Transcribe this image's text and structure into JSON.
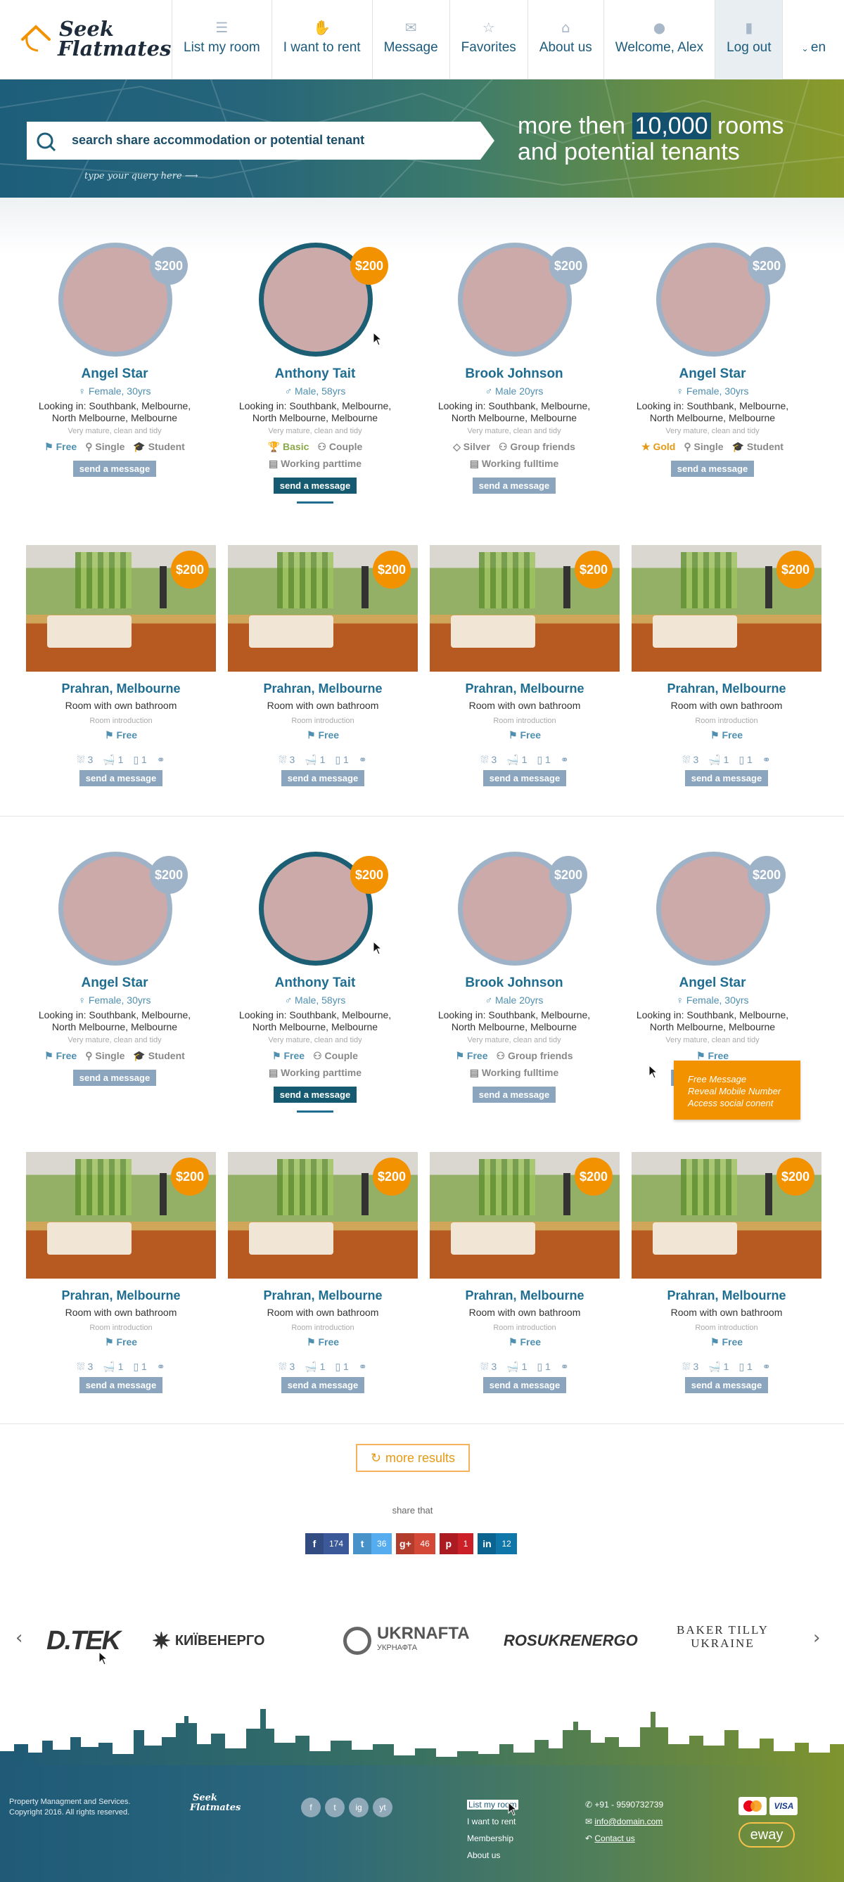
{
  "brand": {
    "line1": "Seek",
    "line2": "Flatmates"
  },
  "nav": [
    {
      "label": "List my room",
      "icon": "list-icon"
    },
    {
      "label": "I want to rent",
      "icon": "handshake-icon"
    },
    {
      "label": "Message",
      "icon": "envelope-icon"
    },
    {
      "label": "Favorites",
      "icon": "star-icon"
    },
    {
      "label": "About us",
      "icon": "house-icon"
    },
    {
      "label": "Welcome, Alex",
      "icon": "user-icon"
    },
    {
      "label": "Log out",
      "icon": "door-icon"
    }
  ],
  "lang": {
    "label": "en",
    "icon": "chevron-down-icon"
  },
  "hero": {
    "search_placeholder": "search share accommodation or potential tenant",
    "hint": "type your query here",
    "line1_pre": "more then ",
    "line1_num": "10,000",
    "line1_post": " rooms",
    "line2": "and potential tenants"
  },
  "people_row": [
    {
      "name": "Angel Star",
      "meta": "Female, 30yrs",
      "gender": "female",
      "price": "$200",
      "looking1": "Looking in: Southbank, Melbourne,",
      "looking2": "North Melbourne, Melbourne",
      "desc": "Very mature, clean and tidy",
      "plan": "Free",
      "plan_style": "blue",
      "type": "Single",
      "type3": "Student",
      "work": "",
      "active": false
    },
    {
      "name": "Anthony Tait",
      "meta": "Male, 58yrs",
      "gender": "male",
      "price": "$200",
      "looking1": "Looking in: Southbank, Melbourne,",
      "looking2": "North Melbourne, Melbourne",
      "desc": "Very mature, clean and tidy",
      "plan": "Basic",
      "plan_style": "green",
      "type": "Couple",
      "type3": "",
      "work": "Working parttime",
      "active": true
    },
    {
      "name": "Brook Johnson",
      "meta": "Male 20yrs",
      "gender": "male",
      "price": "$200",
      "looking1": "Looking in: Southbank, Melbourne,",
      "looking2": "North Melbourne, Melbourne",
      "desc": "Very mature, clean and tidy",
      "plan": "Silver",
      "plan_style": "",
      "type": "Group friends",
      "type3": "",
      "work": "Working fulltime",
      "active": false
    },
    {
      "name": "Angel Star",
      "meta": "Female, 30yrs",
      "gender": "female",
      "price": "$200",
      "looking1": "Looking in: Southbank, Melbourne,",
      "looking2": "North Melbourne, Melbourne",
      "desc": "Very mature, clean and tidy",
      "plan": "Gold",
      "plan_style": "gold",
      "type": "Single",
      "type3": "Student",
      "work": "",
      "active": false
    }
  ],
  "people_row2": [
    {
      "name": "Angel Star",
      "meta": "Female, 30yrs",
      "gender": "female",
      "price": "$200",
      "looking1": "Looking in: Southbank, Melbourne,",
      "looking2": "North Melbourne, Melbourne",
      "desc": "Very mature, clean and tidy",
      "plan": "Free",
      "plan_style": "blue",
      "type": "Single",
      "type3": "Student",
      "work": "",
      "active": false
    },
    {
      "name": "Anthony Tait",
      "meta": "Male, 58yrs",
      "gender": "male",
      "price": "$200",
      "looking1": "Looking in: Southbank, Melbourne,",
      "looking2": "North Melbourne, Melbourne",
      "desc": "Very mature, clean and tidy",
      "plan": "Free",
      "plan_style": "blue",
      "type": "Couple",
      "type3": "",
      "work": "Working parttime",
      "active": true
    },
    {
      "name": "Brook Johnson",
      "meta": "Male 20yrs",
      "gender": "male",
      "price": "$200",
      "looking1": "Looking in: Southbank, Melbourne,",
      "looking2": "North Melbourne, Melbourne",
      "desc": "Very mature, clean and tidy",
      "plan": "Free",
      "plan_style": "blue",
      "type": "Group friends",
      "type3": "",
      "work": "Working fulltime",
      "active": false
    },
    {
      "name": "Angel Star",
      "meta": "Female, 30yrs",
      "gender": "female",
      "price": "$200",
      "looking1": "Looking in: Southbank, Melbourne,",
      "looking2": "North Melbourne, Melbourne",
      "desc": "Very mature, clean and tidy",
      "plan": "Free",
      "plan_style": "blue",
      "type": "",
      "type3": "",
      "work": "",
      "active": false
    }
  ],
  "room": {
    "price": "$200",
    "city": "Prahran, Melbourne",
    "type": "Room with own bathroom",
    "intro": "Room introduction",
    "plan": "Free",
    "beds": "3",
    "baths": "1",
    "toilets": "1"
  },
  "send_label": "send a message",
  "tooltip": [
    "Free Message",
    "Reveal Mobile Number",
    "Access social conent"
  ],
  "more_label": "more results",
  "share": {
    "title": "share that",
    "items": [
      {
        "icon": "f",
        "count": "174",
        "color": "#3b5998"
      },
      {
        "icon": "t",
        "count": "36",
        "color": "#55acee"
      },
      {
        "icon": "g+",
        "count": "46",
        "color": "#d34836"
      },
      {
        "icon": "p",
        "count": "1",
        "color": "#cb2027"
      },
      {
        "icon": "in",
        "count": "12",
        "color": "#0e76a8"
      }
    ]
  },
  "partners": [
    "D.TEK",
    "КИЇВЕНЕРГО",
    "UKRNAFTA",
    "УКРНАФТА",
    "ROSUKRENERGO",
    "BAKER TILLY",
    "UKRAINE"
  ],
  "footer": {
    "copy1": "Property Managment and Services.",
    "copy2": "Copyright 2016. All rights reserved.",
    "logo1": "Seek",
    "logo2": "Flatmates",
    "social": [
      "f",
      "t",
      "ig",
      "yt"
    ],
    "links": [
      "List my room",
      "I want to rent",
      "Membership",
      "About us"
    ],
    "phone": "+91 - 9590732739",
    "email": "info@domain.com",
    "contact": "Contact us",
    "visa": "VISA",
    "eway": "eway"
  }
}
